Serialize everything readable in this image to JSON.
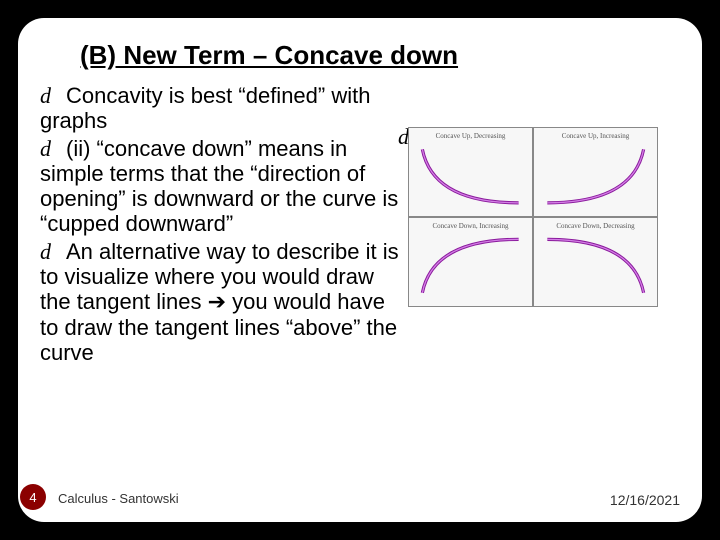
{
  "title": "(B) New Term – Concave down",
  "bullets": [
    "Concavity is best “defined” with graphs",
    "(ii) “concave down” means in simple terms that the “direction of opening” is downward or the  curve is “cupped downward”",
    "An alternative way to describe it is to visualize where you would draw the tangent lines ➔ you would have to draw the tangent lines “above” the curve"
  ],
  "page_number": "4",
  "footer_center": "Calculus - Santowski",
  "footer_date": "12/16/2021",
  "cells": {
    "tl": "Concave Up, Decreasing",
    "tr": "Concave Up, Increasing",
    "bl": "Concave Down, Increasing",
    "br": "Concave Down, Decreasing"
  }
}
